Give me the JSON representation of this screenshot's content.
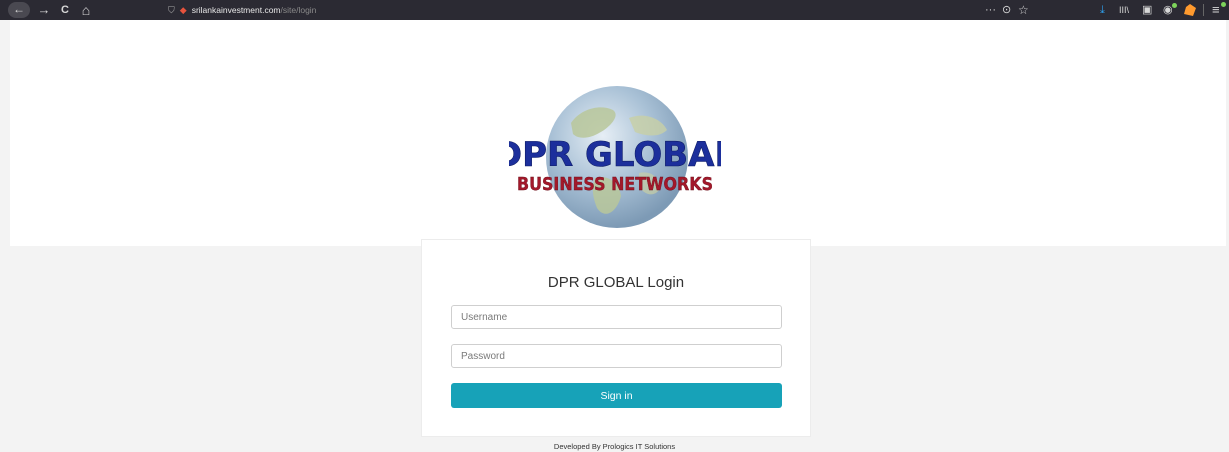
{
  "browser": {
    "url_domain": "srilankainvestment.com",
    "url_path": "/site/login",
    "icons": {
      "back": "←",
      "forward": "→",
      "reload": "C",
      "home": "⌂",
      "shield": "⛉",
      "site": "◆",
      "more": "···",
      "pocket": "⊙",
      "bookmark": "☆",
      "download": "⤓",
      "library": "III\\",
      "sidebar": "▣",
      "extension": "◉",
      "menu": "≡"
    }
  },
  "logo": {
    "line1": "DPR GLOBAL",
    "line2": "BUSINESS NETWORKS",
    "colors": {
      "line1": "#1c2f9c",
      "line2": "#a3182a",
      "globe": "#9fb7cc"
    }
  },
  "login": {
    "title": "DPR GLOBAL Login",
    "username_placeholder": "Username",
    "password_placeholder": "Password",
    "signin_label": "Sign in",
    "accent": "#17a2b8"
  },
  "footer": {
    "credit": "Developed By Prologics IT Solutions"
  }
}
